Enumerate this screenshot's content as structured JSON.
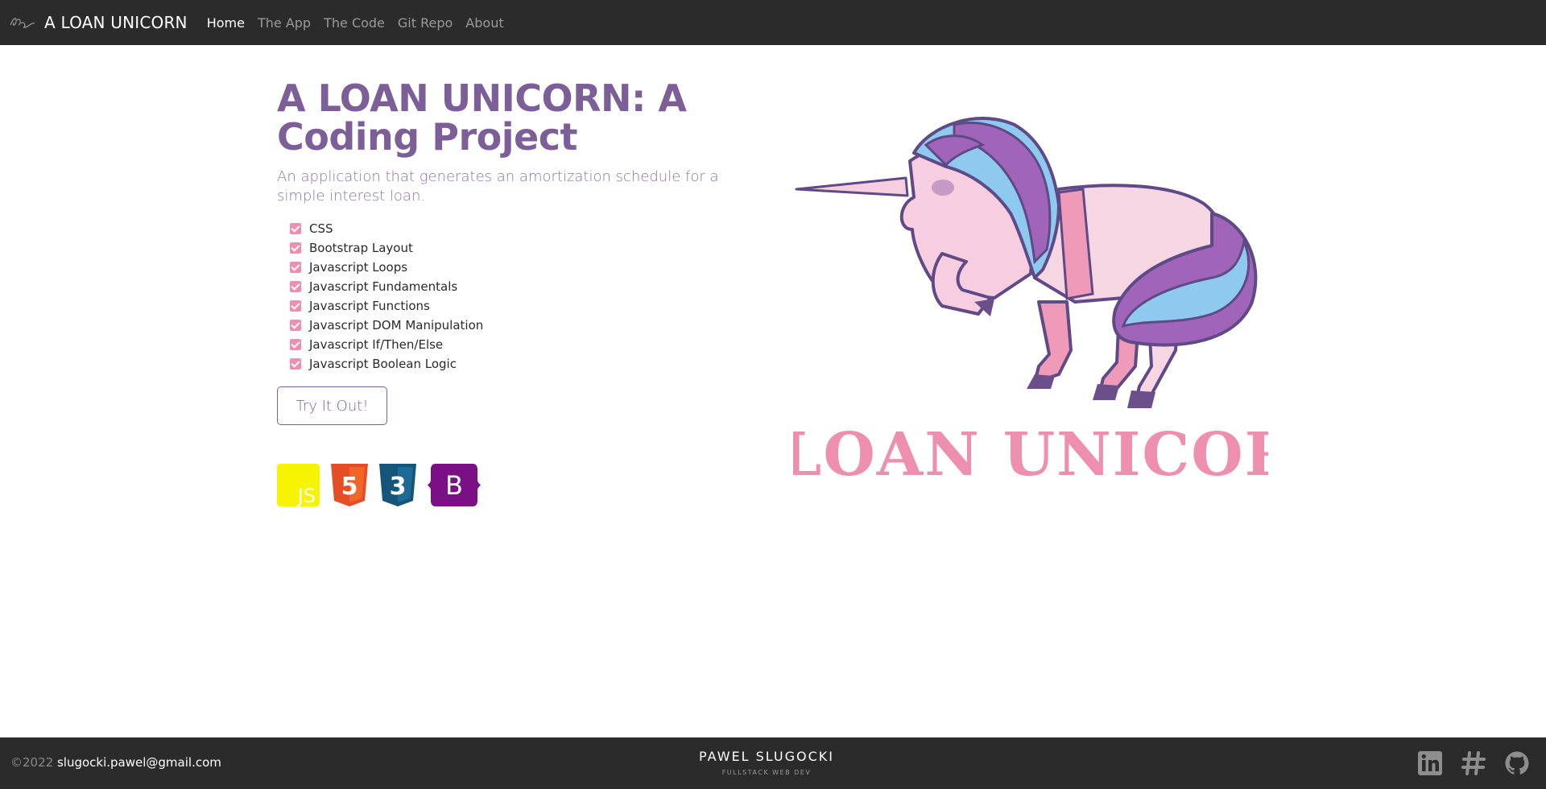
{
  "navbar": {
    "brand_name": "A LOAN UNICORN",
    "links": [
      {
        "label": "Home",
        "active": true
      },
      {
        "label": "The App"
      },
      {
        "label": "The Code"
      },
      {
        "label": "Git Repo"
      },
      {
        "label": "About"
      }
    ]
  },
  "hero": {
    "title": "A LOAN UNICORN: A Coding Project",
    "lead": "An application that generates an amortization schedule for a simple interest loan.",
    "skills": [
      "CSS",
      "Bootstrap Layout",
      "Javascript Loops",
      "Javascript Fundamentals",
      "Javascript Functions",
      "Javascript DOM Manipulation",
      "Javascript If/Then/Else",
      "Javascript Boolean Logic"
    ],
    "cta_label": "Try It Out!",
    "tech_icons": [
      {
        "name": "javascript-icon",
        "text": "JS",
        "color": "#f7f400"
      },
      {
        "name": "html5-icon",
        "text": "5",
        "color": "#e44d26"
      },
      {
        "name": "css3-icon",
        "text": "3",
        "color": "#15557a"
      },
      {
        "name": "bootstrap-icon",
        "text": "B",
        "color": "#7b0f85"
      }
    ],
    "art_text": "A LOAN UNICORN"
  },
  "footer": {
    "copyright": "©2022",
    "email": "slugocki.pawel@gmail.com",
    "name": "PAWEL SLUGOCKI",
    "role": "FULLSTACK WEB DEV",
    "social_icons": [
      "linkedin-icon",
      "hashtag-icon",
      "github-icon"
    ]
  },
  "colors": {
    "accent_purple": "#7d5f98",
    "pink": "#ee8fb0",
    "navbar_bg": "#2b2b2b"
  }
}
